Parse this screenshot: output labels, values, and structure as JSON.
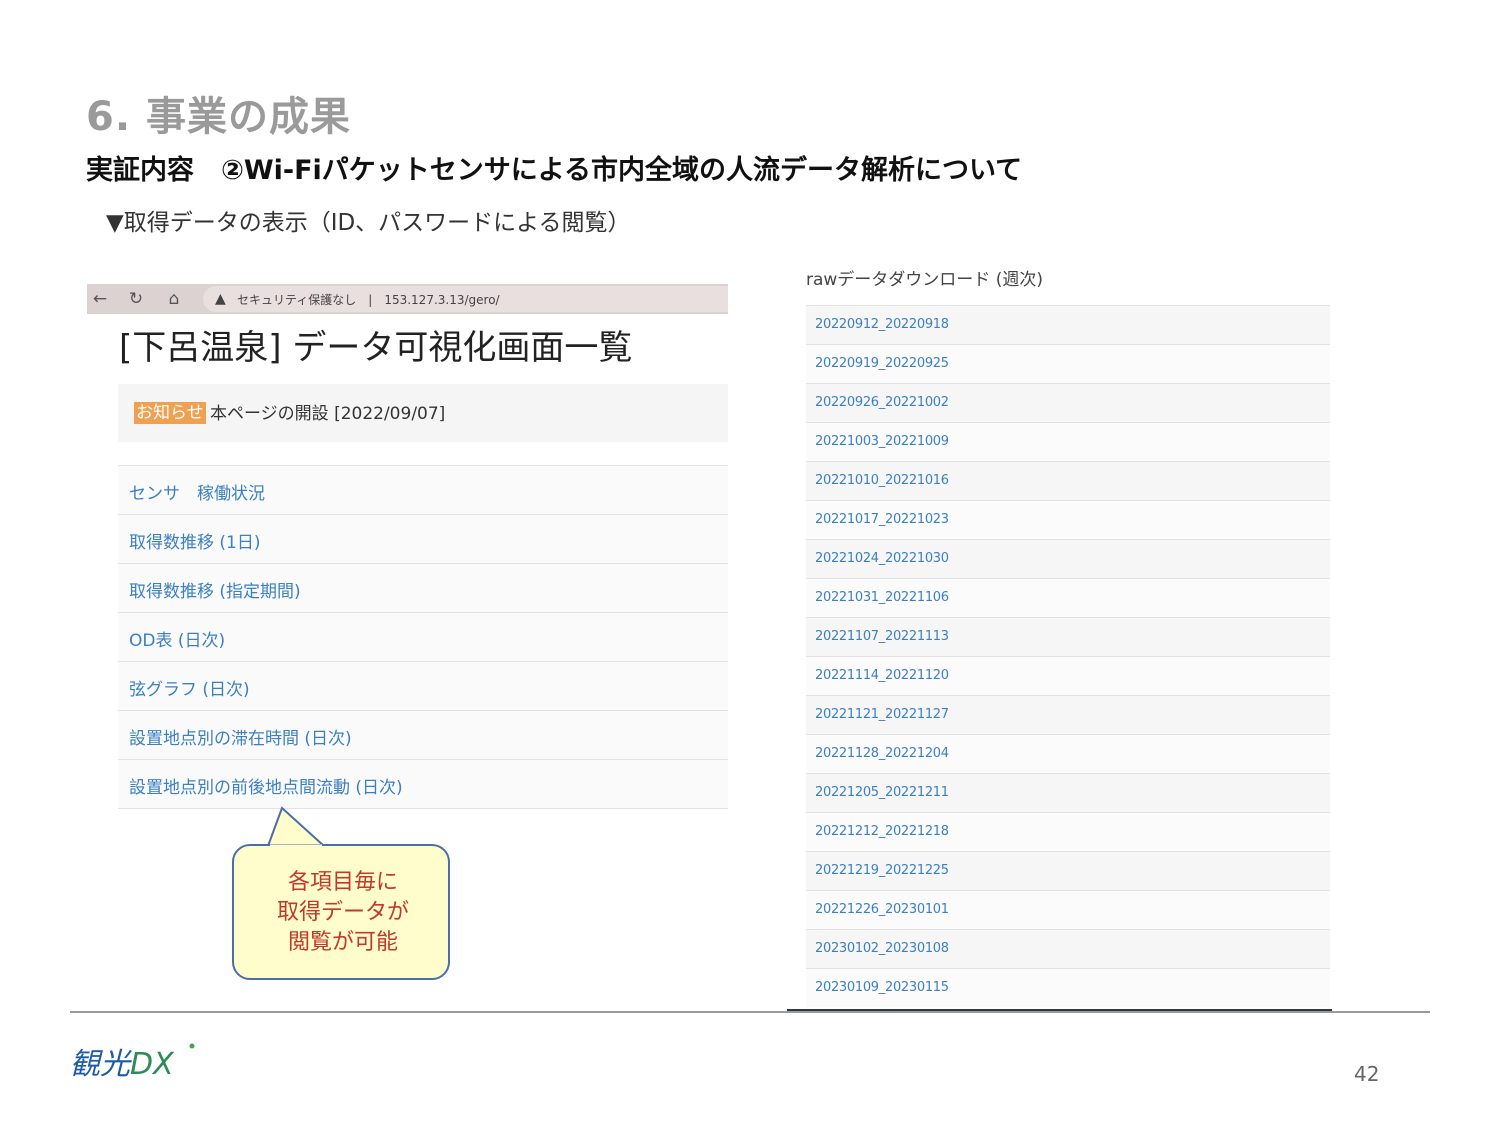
{
  "slide": {
    "title": "6. 事業の成果",
    "subtitle": "実証内容　②Wi-Fiパケットセンサによる市内全域の人流データ解析について",
    "caption": "▼取得データの表示（ID、パスワードによる閲覧）",
    "page_number": "42"
  },
  "left_screenshot": {
    "browser": {
      "security_label": "セキュリティ保護なし",
      "url": "153.127.3.13/gero/"
    },
    "heading": "[下呂温泉] データ可視化画面一覧",
    "notice": {
      "badge": "お知らせ",
      "text": "本ページの開設 [2022/09/07]"
    },
    "menu_items": [
      "センサ　稼働状況",
      "取得数推移 (1日)",
      "取得数推移 (指定期間)",
      "OD表 (日次)",
      "弦グラフ (日次)",
      "設置地点別の滞在時間 (日次)",
      "設置地点別の前後地点間流動 (日次)"
    ]
  },
  "callout": {
    "lines": [
      "各項目毎に",
      "取得データが",
      "閲覧が可能"
    ]
  },
  "right_screenshot": {
    "heading": "rawデータダウンロード (週次)",
    "items": [
      "20220912_20220918",
      "20220919_20220925",
      "20220926_20221002",
      "20221003_20221009",
      "20221010_20221016",
      "20221017_20221023",
      "20221024_20221030",
      "20221031_20221106",
      "20221107_20221113",
      "20221114_20221120",
      "20221121_20221127",
      "20221128_20221204",
      "20221205_20221211",
      "20221212_20221218",
      "20221219_20221225",
      "20221226_20230101",
      "20230102_20230108",
      "20230109_20230115"
    ]
  },
  "footer": {
    "logo_text": "観光DX"
  },
  "colors": {
    "title_gray": "#9a9a9a",
    "link_blue": "#3b7fc4",
    "badge_orange": "#f0a050",
    "callout_fill": "#fefdcb",
    "callout_border": "#4b6ea9",
    "callout_text": "#c0392b"
  }
}
